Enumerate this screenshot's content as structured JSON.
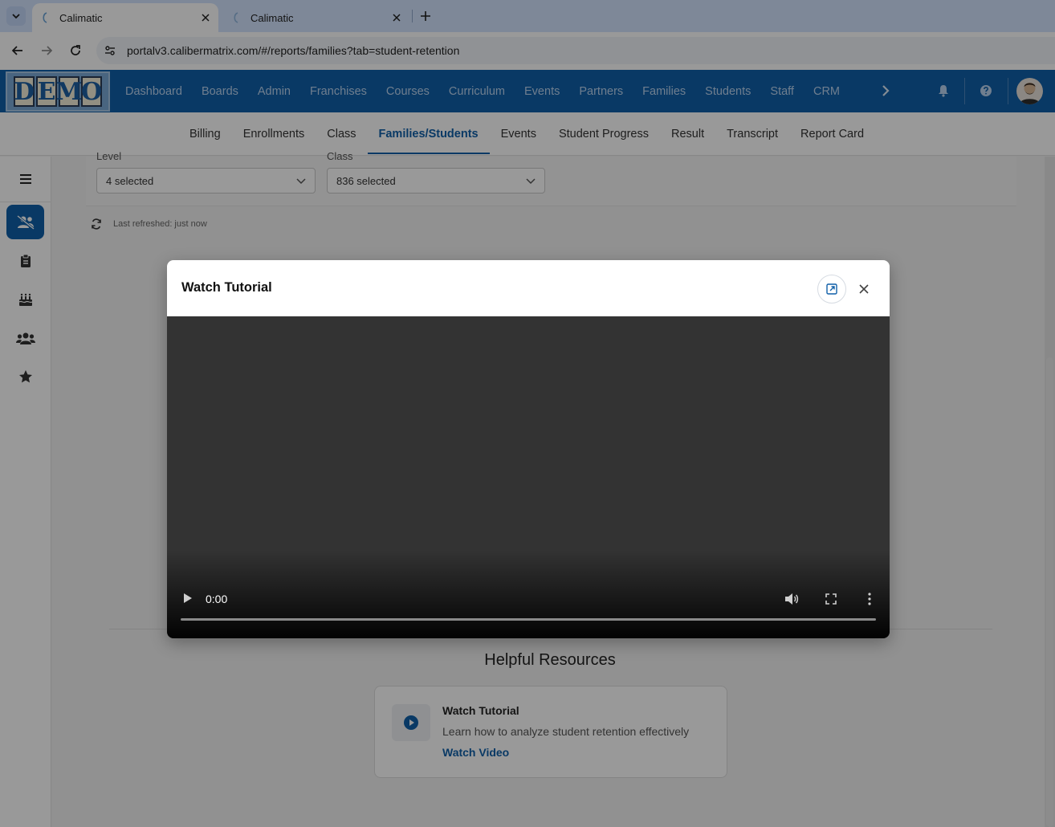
{
  "browser": {
    "tabs": [
      {
        "title": "Calimatic",
        "active": true
      },
      {
        "title": "Calimatic",
        "active": false
      }
    ],
    "url": "portalv3.calibermatrix.com/#/reports/families?tab=student-retention"
  },
  "header": {
    "logo_letters": [
      "D",
      "E",
      "M",
      "O"
    ],
    "nav": [
      "Dashboard",
      "Boards",
      "Admin",
      "Franchises",
      "Courses",
      "Curriculum",
      "Events",
      "Partners",
      "Families",
      "Students",
      "Staff",
      "CRM"
    ]
  },
  "subnav": {
    "items": [
      "Billing",
      "Enrollments",
      "Class",
      "Families/Students",
      "Events",
      "Student Progress",
      "Result",
      "Transcript",
      "Report Card"
    ],
    "active": "Families/Students"
  },
  "filters": {
    "level_label": "Level",
    "level_value": "4 selected",
    "class_label": "Class",
    "class_value": "836 selected"
  },
  "refresh": {
    "text": "Last refreshed: just now"
  },
  "resources": {
    "title": "Helpful Resources",
    "card_title": "Watch Tutorial",
    "card_desc": "Learn how to analyze student retention effectively",
    "card_link": "Watch Video"
  },
  "modal": {
    "title": "Watch Tutorial",
    "video_time": "0:00",
    "video_progress": 0
  },
  "colors": {
    "brand": "#0f5fa8",
    "video_bg": "#333333"
  }
}
